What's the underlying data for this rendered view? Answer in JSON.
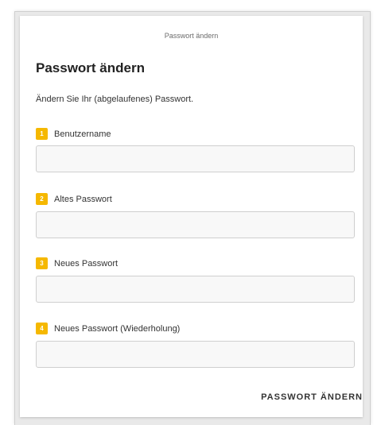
{
  "dialog": {
    "header": "Passwort ändern",
    "title": "Passwort ändern",
    "description": "Ändern Sie Ihr (abgelaufenes) Passwort.",
    "submit_label": "PASSWORT ÄNDERN"
  },
  "fields": [
    {
      "step": "1",
      "label": "Benutzername",
      "value": ""
    },
    {
      "step": "2",
      "label": "Altes Passwort",
      "value": ""
    },
    {
      "step": "3",
      "label": "Neues Passwort",
      "value": ""
    },
    {
      "step": "4",
      "label": "Neues Passwort (Wiederholung)",
      "value": ""
    }
  ],
  "colors": {
    "badge": "#f5b800",
    "text": "#333333",
    "input_background": "#f8f8f8",
    "input_border": "#cfcfcf"
  }
}
